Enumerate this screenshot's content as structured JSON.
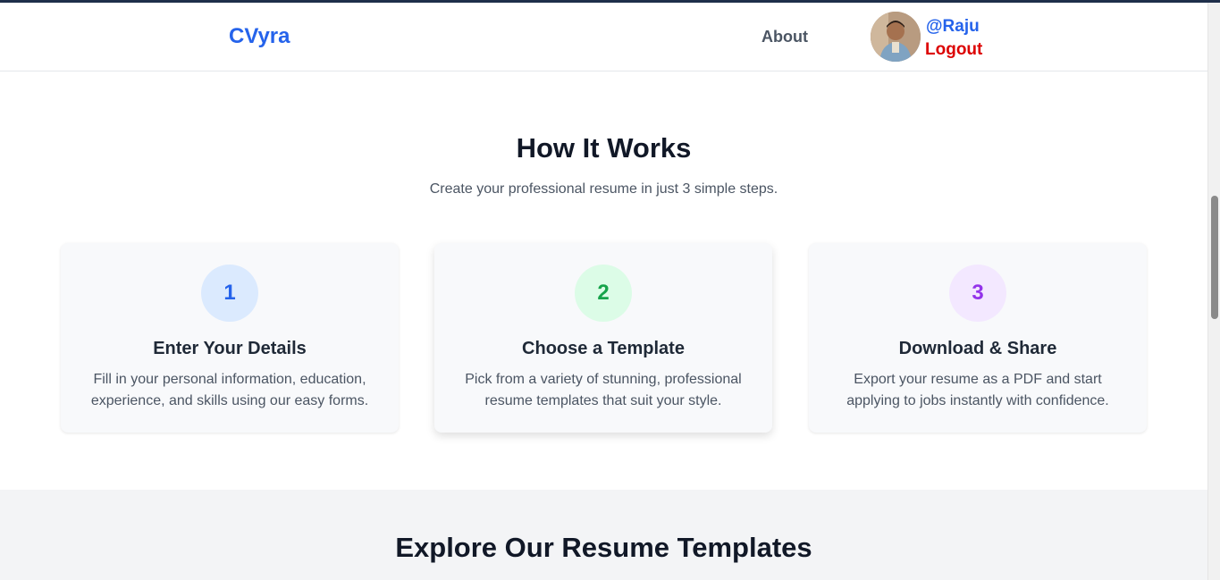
{
  "nav": {
    "brand": "CVyra",
    "about": "About",
    "user_handle": "@Raju",
    "logout": "Logout"
  },
  "how_it_works": {
    "title": "How It Works",
    "subtitle": "Create your professional resume in just 3 simple steps.",
    "steps": [
      {
        "number": "1",
        "title": "Enter Your Details",
        "desc_line1": "Fill in your personal information, education,",
        "desc_line2": "experience, and skills using our easy forms.",
        "circle_bg": "#dbeafe",
        "number_color": "#2563eb"
      },
      {
        "number": "2",
        "title": "Choose a Template",
        "desc_line1": "Pick from a variety of stunning, professional",
        "desc_line2": "resume templates that suit your style.",
        "circle_bg": "#dcfce7",
        "number_color": "#16a34a"
      },
      {
        "number": "3",
        "title": "Download & Share",
        "desc_line1": "Export your resume as a PDF and start",
        "desc_line2": "applying to jobs instantly with confidence.",
        "circle_bg": "#f3e8ff",
        "number_color": "#9333ea"
      }
    ]
  },
  "explore": {
    "title": "Explore Our Resume Templates"
  },
  "colors": {
    "brand_blue": "#2563eb",
    "logout_red": "#dc0000"
  }
}
